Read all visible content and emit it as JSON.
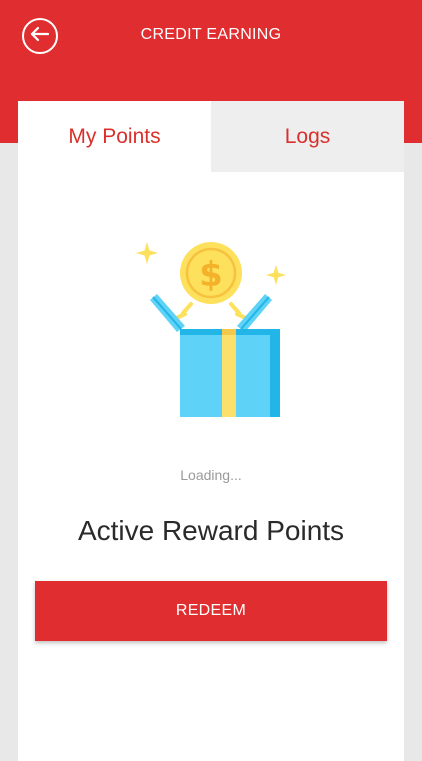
{
  "header": {
    "title": "CREDIT EARNING",
    "back_icon": "back-arrow-icon",
    "background_color": "#e02d2f"
  },
  "tabs": [
    {
      "label": "My Points",
      "active": true
    },
    {
      "label": "Logs",
      "active": false
    }
  ],
  "illustration": {
    "icon": "gift-box-coin-icon",
    "coin_symbol": "$"
  },
  "status": {
    "loading_text": "Loading..."
  },
  "points": {
    "label": "Active Reward Points"
  },
  "actions": {
    "redeem_label": "REDEEM"
  },
  "colors": {
    "accent": "#e02d2f",
    "tab_text": "#d9302c",
    "box_blue": "#5fd3f7",
    "ribbon_yellow": "#fbe06b",
    "coin_yellow": "#fde05c"
  }
}
